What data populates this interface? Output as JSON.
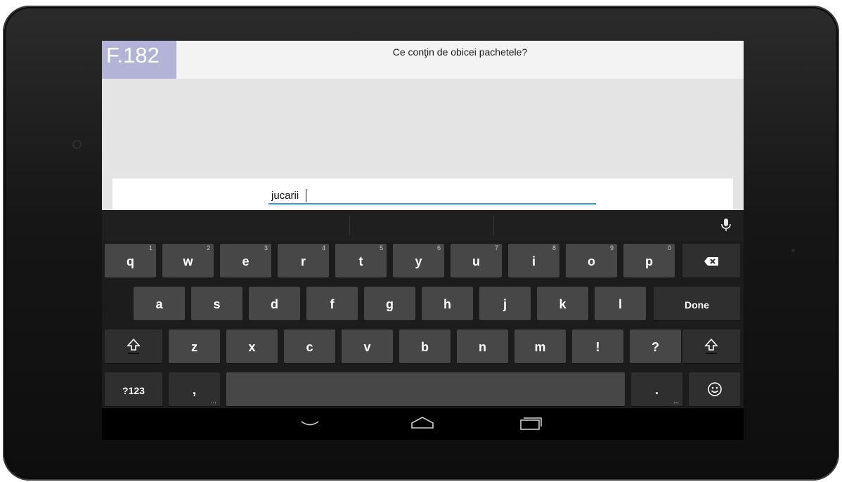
{
  "app": {
    "level_label": "F.182",
    "question": "Ce conţin de obicei pachetele?",
    "answer_value": "jucarii"
  },
  "keyboard": {
    "row1": [
      {
        "label": "q",
        "hint": "1"
      },
      {
        "label": "w",
        "hint": "2"
      },
      {
        "label": "e",
        "hint": "3"
      },
      {
        "label": "r",
        "hint": "4"
      },
      {
        "label": "t",
        "hint": "5"
      },
      {
        "label": "y",
        "hint": "6"
      },
      {
        "label": "u",
        "hint": "7"
      },
      {
        "label": "i",
        "hint": "8"
      },
      {
        "label": "o",
        "hint": "9"
      },
      {
        "label": "p",
        "hint": "0"
      }
    ],
    "row2": [
      "a",
      "s",
      "d",
      "f",
      "g",
      "h",
      "j",
      "k",
      "l"
    ],
    "done_label": "Done",
    "row3": [
      "z",
      "x",
      "c",
      "v",
      "b",
      "n",
      "m",
      "!",
      "?"
    ],
    "symbols_label": "?123",
    "comma_label": ",",
    "period_label": ".",
    "icons": {
      "mic": "microphone-icon",
      "backspace": "backspace-icon",
      "shift": "shift-icon",
      "emoji": "emoji-icon"
    }
  },
  "navbar": {
    "icons": [
      "back-icon",
      "home-icon",
      "recents-icon"
    ]
  },
  "colors": {
    "badge": "#b3b3d8",
    "input_underline": "#3a96d6",
    "key": "#474747",
    "key_dark": "#2f2f2f"
  }
}
